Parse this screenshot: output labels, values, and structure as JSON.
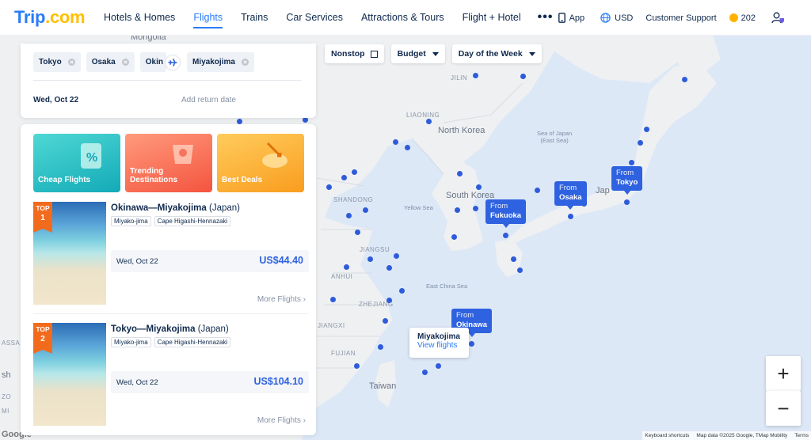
{
  "header": {
    "logo": "Trip",
    "logo_suffix": ".com",
    "nav": [
      {
        "label": "Hotels & Homes"
      },
      {
        "label": "Flights",
        "active": true
      },
      {
        "label": "Trains"
      },
      {
        "label": "Car Services"
      },
      {
        "label": "Attractions & Tours"
      },
      {
        "label": "Flight + Hotel"
      }
    ],
    "more_label": "•••",
    "app_label": "App",
    "currency_label": "USD",
    "support_label": "Customer Support",
    "coins": "202",
    "icons": [
      "phone-icon",
      "globe-icon",
      "coin-icon",
      "user-icon"
    ]
  },
  "search": {
    "chips": [
      "Tokyo",
      "Osaka",
      "Okin",
      "Miyakojima"
    ],
    "date": "Wed, Oct 22",
    "return_placeholder": "Add return date"
  },
  "filters": {
    "nonstop": "Nonstop",
    "budget": "Budget",
    "day_of_week": "Day of the Week"
  },
  "categories": [
    {
      "label": "Cheap Flights"
    },
    {
      "label": "Trending Destinations"
    },
    {
      "label": "Best Deals"
    }
  ],
  "results": [
    {
      "rank_label": "TOP",
      "rank": "1",
      "route": "Okinawa—Miyakojima",
      "country": "(Japan)",
      "tags": [
        "Miyako-jima",
        "Cape Higashi-Hennazaki"
      ],
      "date": "Wed, Oct 22",
      "price": "US$44.40",
      "more": "More Flights"
    },
    {
      "rank_label": "TOP",
      "rank": "2",
      "route": "Tokyo—Miyakojima",
      "country": "(Japan)",
      "tags": [
        "Miyako-jima",
        "Cape Higashi-Hennazaki"
      ],
      "date": "Wed, Oct 22",
      "price": "US$104.10",
      "more": "More Flights"
    }
  ],
  "map": {
    "labels": {
      "mongolia": "Mongolia",
      "jilin": "JILIN",
      "liaoning": "LIAONING",
      "north_korea": "North Korea",
      "sea_japan": "Sea of Japan\n(East Sea)",
      "japan": "Jap",
      "south_korea": "South Korea",
      "shandong": "SHANDONG",
      "yellow_sea": "Yellow Sea",
      "jiangsu": "JIANGSU",
      "anhui": "ANHUI",
      "zhejiang": "ZHEJIANG",
      "east_china_sea": "East China Sea",
      "fujian": "FUJIAN",
      "jiangxi": "JIANGXI",
      "taiwan": "Taiwan",
      "assa": "ASSA",
      "sh": "sh",
      "zo": "ZO",
      "mi": "MI",
      "google": "Google"
    },
    "from_prefix": "From",
    "pins": [
      {
        "city": "Tokyo"
      },
      {
        "city": "Osaka"
      },
      {
        "city": "Fukuoka"
      },
      {
        "city": "Okinawa"
      }
    ],
    "tooltip_title": "Miyakojima",
    "tooltip_link": "View flights",
    "zoom_in": "+",
    "zoom_out": "−",
    "attribution": [
      "Keyboard shortcuts",
      "Map data ©2025 Google, TMap Mobility",
      "Terms"
    ]
  },
  "colors": {
    "brand_blue": "#287dfa",
    "pin_blue": "#2f62e0",
    "badge_orange": "#f26b1d",
    "coin_gold": "#ffb300"
  }
}
